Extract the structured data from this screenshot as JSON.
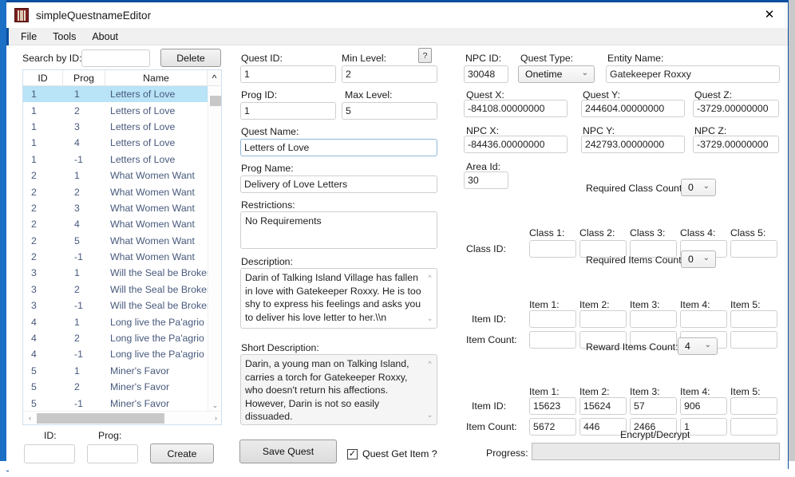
{
  "window": {
    "title": "simpleQuestnameEditor",
    "app_icon": "app-icon",
    "close_label": "✕"
  },
  "menubar": {
    "items": [
      "File",
      "Tools",
      "About"
    ]
  },
  "search": {
    "label": "Search by ID:",
    "value": "",
    "delete_label": "Delete"
  },
  "list": {
    "columns": [
      "ID",
      "Prog",
      "Name"
    ],
    "rows": [
      {
        "id": "1",
        "prog": "1",
        "name": "Letters of Love",
        "selected": true
      },
      {
        "id": "1",
        "prog": "2",
        "name": "Letters of Love"
      },
      {
        "id": "1",
        "prog": "3",
        "name": "Letters of Love"
      },
      {
        "id": "1",
        "prog": "4",
        "name": "Letters of Love"
      },
      {
        "id": "1",
        "prog": "-1",
        "name": "Letters of Love"
      },
      {
        "id": "2",
        "prog": "1",
        "name": "What Women Want"
      },
      {
        "id": "2",
        "prog": "2",
        "name": "What Women Want"
      },
      {
        "id": "2",
        "prog": "3",
        "name": "What Women Want"
      },
      {
        "id": "2",
        "prog": "4",
        "name": "What Women Want"
      },
      {
        "id": "2",
        "prog": "5",
        "name": "What Women Want"
      },
      {
        "id": "2",
        "prog": "-1",
        "name": "What Women Want"
      },
      {
        "id": "3",
        "prog": "1",
        "name": "Will the Seal be Broken?"
      },
      {
        "id": "3",
        "prog": "2",
        "name": "Will the Seal be Broken?"
      },
      {
        "id": "3",
        "prog": "-1",
        "name": "Will the Seal be Broken?"
      },
      {
        "id": "4",
        "prog": "1",
        "name": "Long live the Pa'agrio Lord!"
      },
      {
        "id": "4",
        "prog": "2",
        "name": "Long live the Pa'agrio Lord!"
      },
      {
        "id": "4",
        "prog": "-1",
        "name": "Long live the Pa'agrio Lord!"
      },
      {
        "id": "5",
        "prog": "1",
        "name": "Miner's Favor"
      },
      {
        "id": "5",
        "prog": "2",
        "name": "Miner's Favor"
      },
      {
        "id": "5",
        "prog": "-1",
        "name": "Miner's Favor"
      }
    ]
  },
  "bottom_left": {
    "id_label": "ID:",
    "id_value": "",
    "prog_label": "Prog:",
    "prog_value": "",
    "create_label": "Create"
  },
  "quest": {
    "quest_id_label": "Quest ID:",
    "quest_id": "1",
    "min_level_label": "Min Level:",
    "min_level": "2",
    "help_label": "?",
    "prog_id_label": "Prog ID:",
    "prog_id": "1",
    "max_level_label": "Max Level:",
    "max_level": "5",
    "quest_name_label": "Quest Name:",
    "quest_name": "Letters of Love",
    "prog_name_label": "Prog Name:",
    "prog_name": "Delivery of Love Letters",
    "restrictions_label": "Restrictions:",
    "restrictions": "No Requirements",
    "description_label": "Description:",
    "description": "Darin of Talking Island Village has fallen in love with Gatekeeper Roxxy. He is too shy to express his feelings and asks you to deliver his love letter to her.\\\\n",
    "short_description_label": "Short Description:",
    "short_description": "Darin, a young man on Talking Island, carries a torch for Gatekeeper Roxxy, who doesn't return his affections. However, Darin is not so easily dissuaded.",
    "save_label": "Save Quest",
    "get_item_label": "Quest Get Item ?",
    "get_item_checked": true
  },
  "npc": {
    "npc_id_label": "NPC ID:",
    "npc_id": "30048",
    "quest_type_label": "Quest Type:",
    "quest_type": "Onetime",
    "entity_name_label": "Entity Name:",
    "entity_name": "Gatekeeper Roxxy",
    "quest_x_label": "Quest X:",
    "quest_x": "-84108.00000000",
    "quest_y_label": "Quest Y:",
    "quest_y": "244604.00000000",
    "quest_z_label": "Quest Z:",
    "quest_z": "-3729.00000000",
    "npc_x_label": "NPC X:",
    "npc_x": "-84436.00000000",
    "npc_y_label": "NPC Y:",
    "npc_y": "242793.00000000",
    "npc_z_label": "NPC Z:",
    "npc_z": "-3729.00000000",
    "area_id_label": "Area Id:",
    "area_id": "30"
  },
  "classes": {
    "count_label": "Required Class Count:",
    "count_value": "0",
    "headers": [
      "Class 1:",
      "Class 2:",
      "Class 3:",
      "Class 4:",
      "Class 5:"
    ],
    "row_label": "Class ID:",
    "values": [
      "",
      "",
      "",
      "",
      ""
    ]
  },
  "required_items": {
    "count_label": "Required Items Count:",
    "count_value": "0",
    "headers": [
      "Item 1:",
      "Item 2:",
      "Item 3:",
      "Item 4:",
      "Item 5:"
    ],
    "id_label": "Item ID:",
    "ids": [
      "",
      "",
      "",
      "",
      ""
    ],
    "count_row_label": "Item Count:",
    "counts": [
      "",
      "",
      "",
      "",
      ""
    ]
  },
  "reward_items": {
    "count_label": "Reward Items Count:",
    "count_value": "4",
    "headers": [
      "Item 1:",
      "Item 2:",
      "Item 3:",
      "Item 4:",
      "Item 5:"
    ],
    "id_label": "Item ID:",
    "ids": [
      "15623",
      "15624",
      "57",
      "906",
      ""
    ],
    "count_row_label": "Item Count:",
    "counts": [
      "5672",
      "446",
      "2466",
      "1",
      ""
    ]
  },
  "encrypt": {
    "title": "Encrypt/Decrypt",
    "progress_label": "Progress:",
    "progress_value": ""
  },
  "colors": {
    "titlebar_border": "#0b4f9e",
    "selection": "#b9e3f7",
    "list_text": "#47597c",
    "desktop": "#1b6fc4"
  }
}
